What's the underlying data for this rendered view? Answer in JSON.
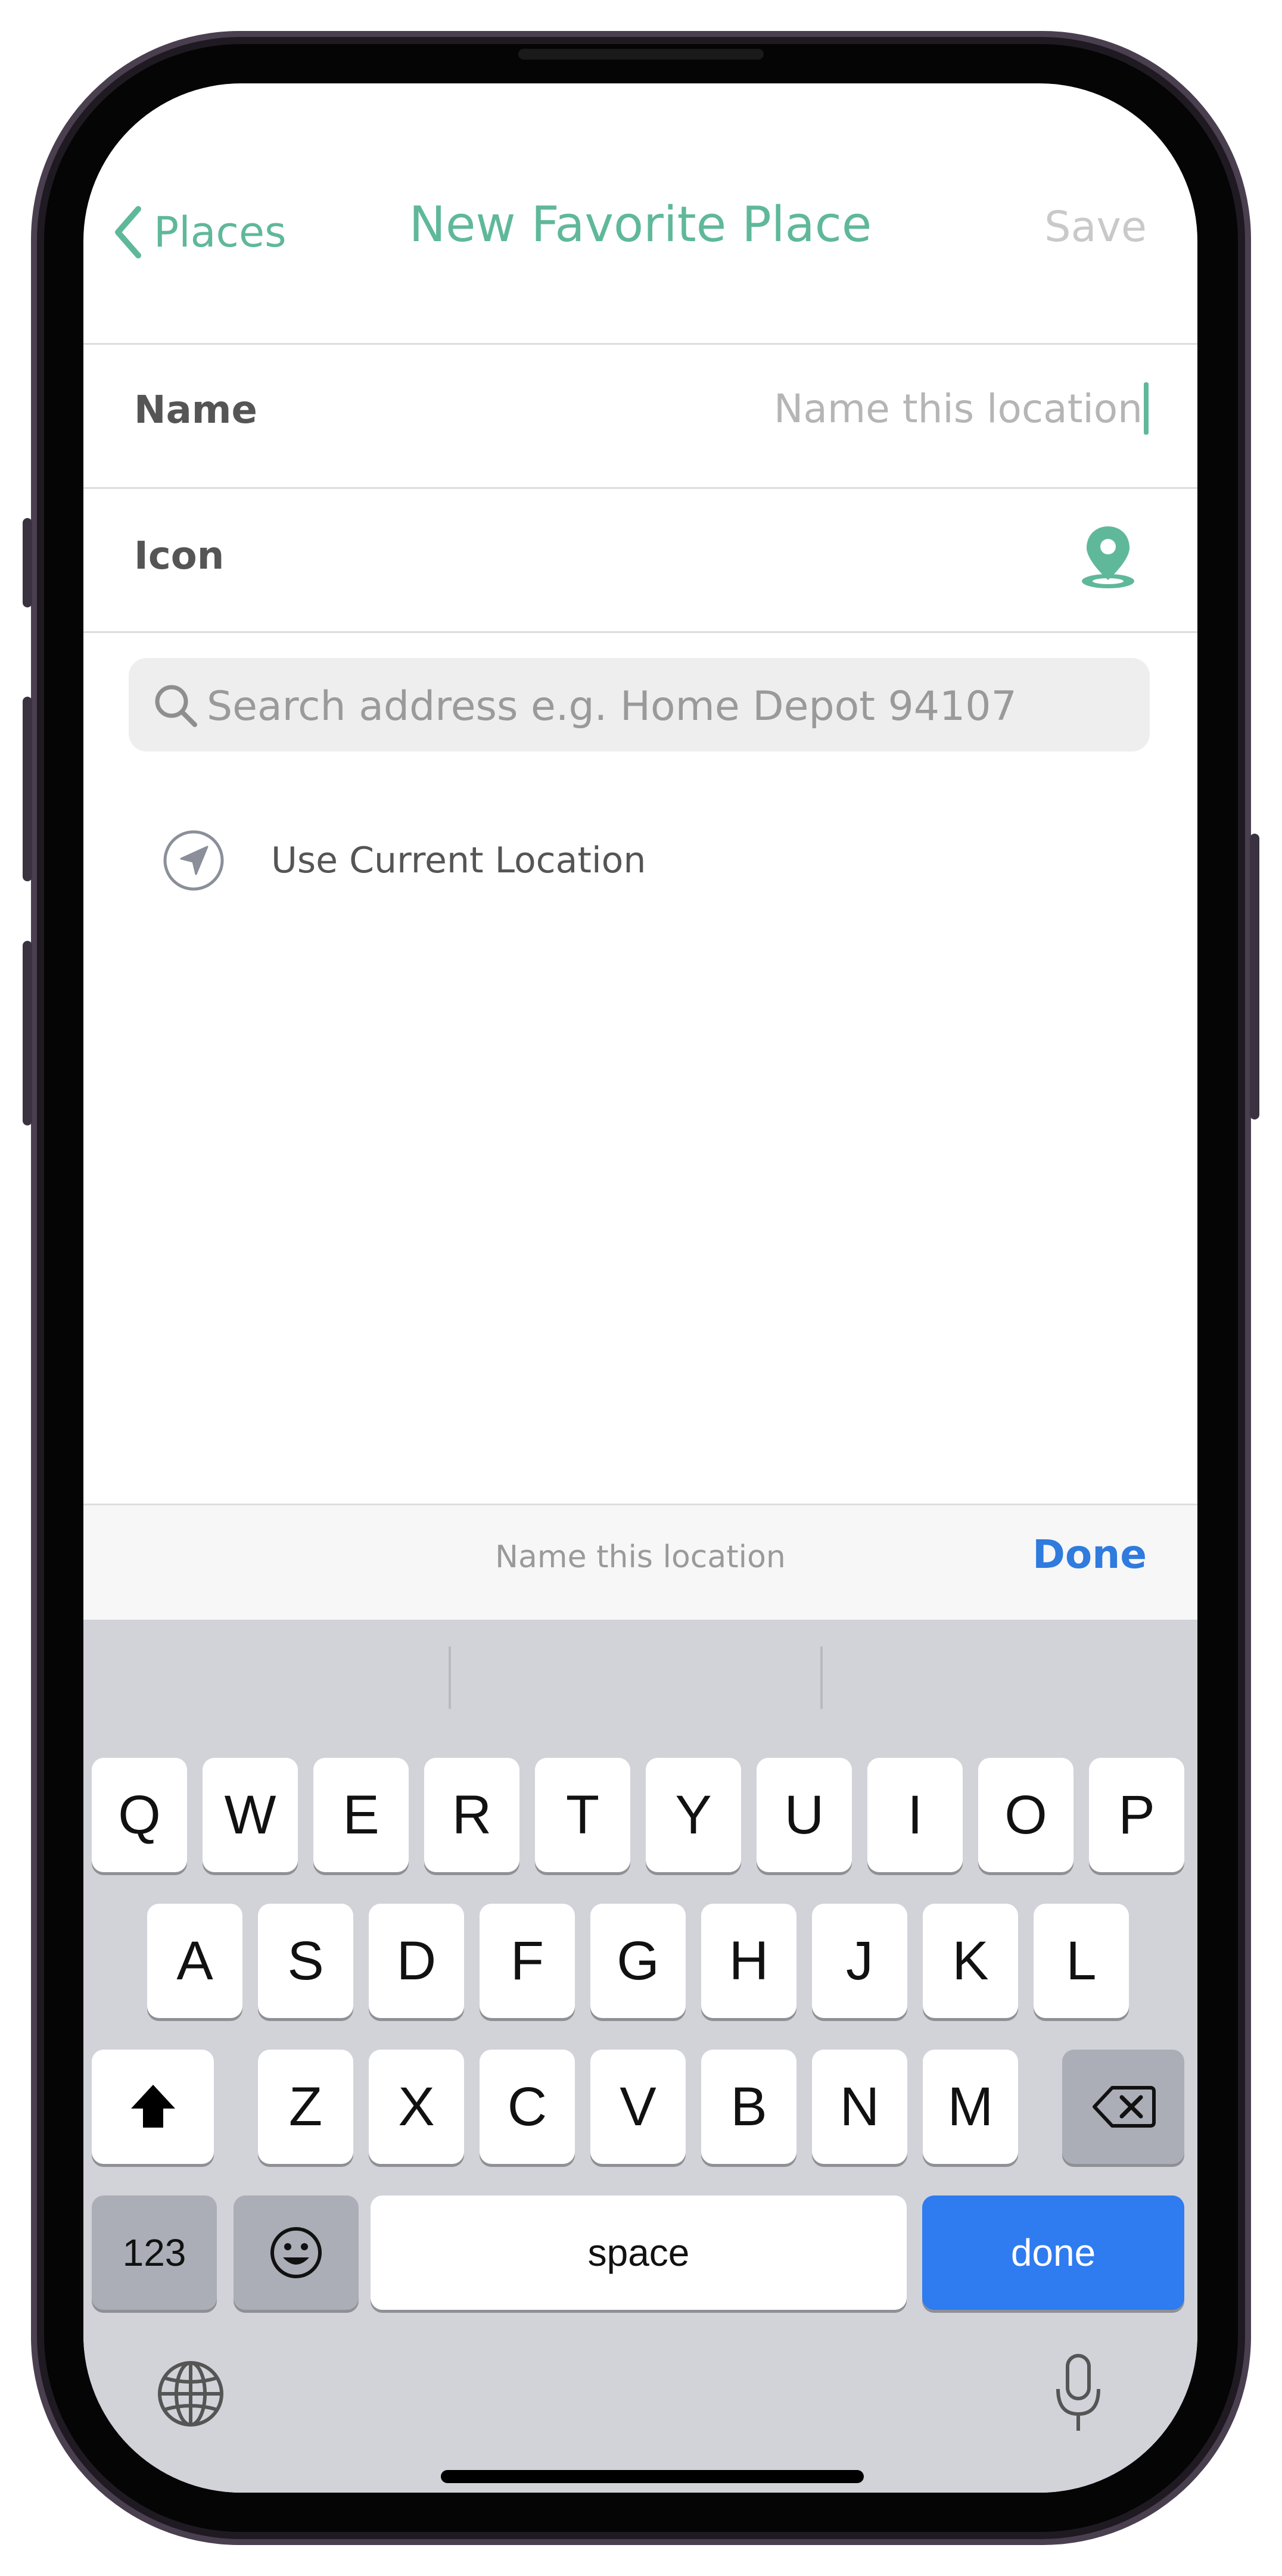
{
  "nav": {
    "back_label": "Places",
    "title": "New Favorite Place",
    "save_label": "Save"
  },
  "form": {
    "name_label": "Name",
    "name_placeholder": "Name this location",
    "icon_label": "Icon",
    "search_placeholder": "Search address e.g. Home Depot 94107",
    "current_location_label": "Use Current Location"
  },
  "accessory": {
    "title": "Name this location",
    "done_label": "Done"
  },
  "keyboard": {
    "row1": [
      "Q",
      "W",
      "E",
      "R",
      "T",
      "Y",
      "U",
      "I",
      "O",
      "P"
    ],
    "row2": [
      "A",
      "S",
      "D",
      "F",
      "G",
      "H",
      "J",
      "K",
      "L"
    ],
    "row3": [
      "Z",
      "X",
      "C",
      "V",
      "B",
      "N",
      "M"
    ],
    "numbers_label": "123",
    "space_label": "space",
    "return_label": "done"
  },
  "colors": {
    "accent": "#5fb89a",
    "done_blue": "#2f7bde",
    "keyboard_bg": "#d2d3d9"
  }
}
